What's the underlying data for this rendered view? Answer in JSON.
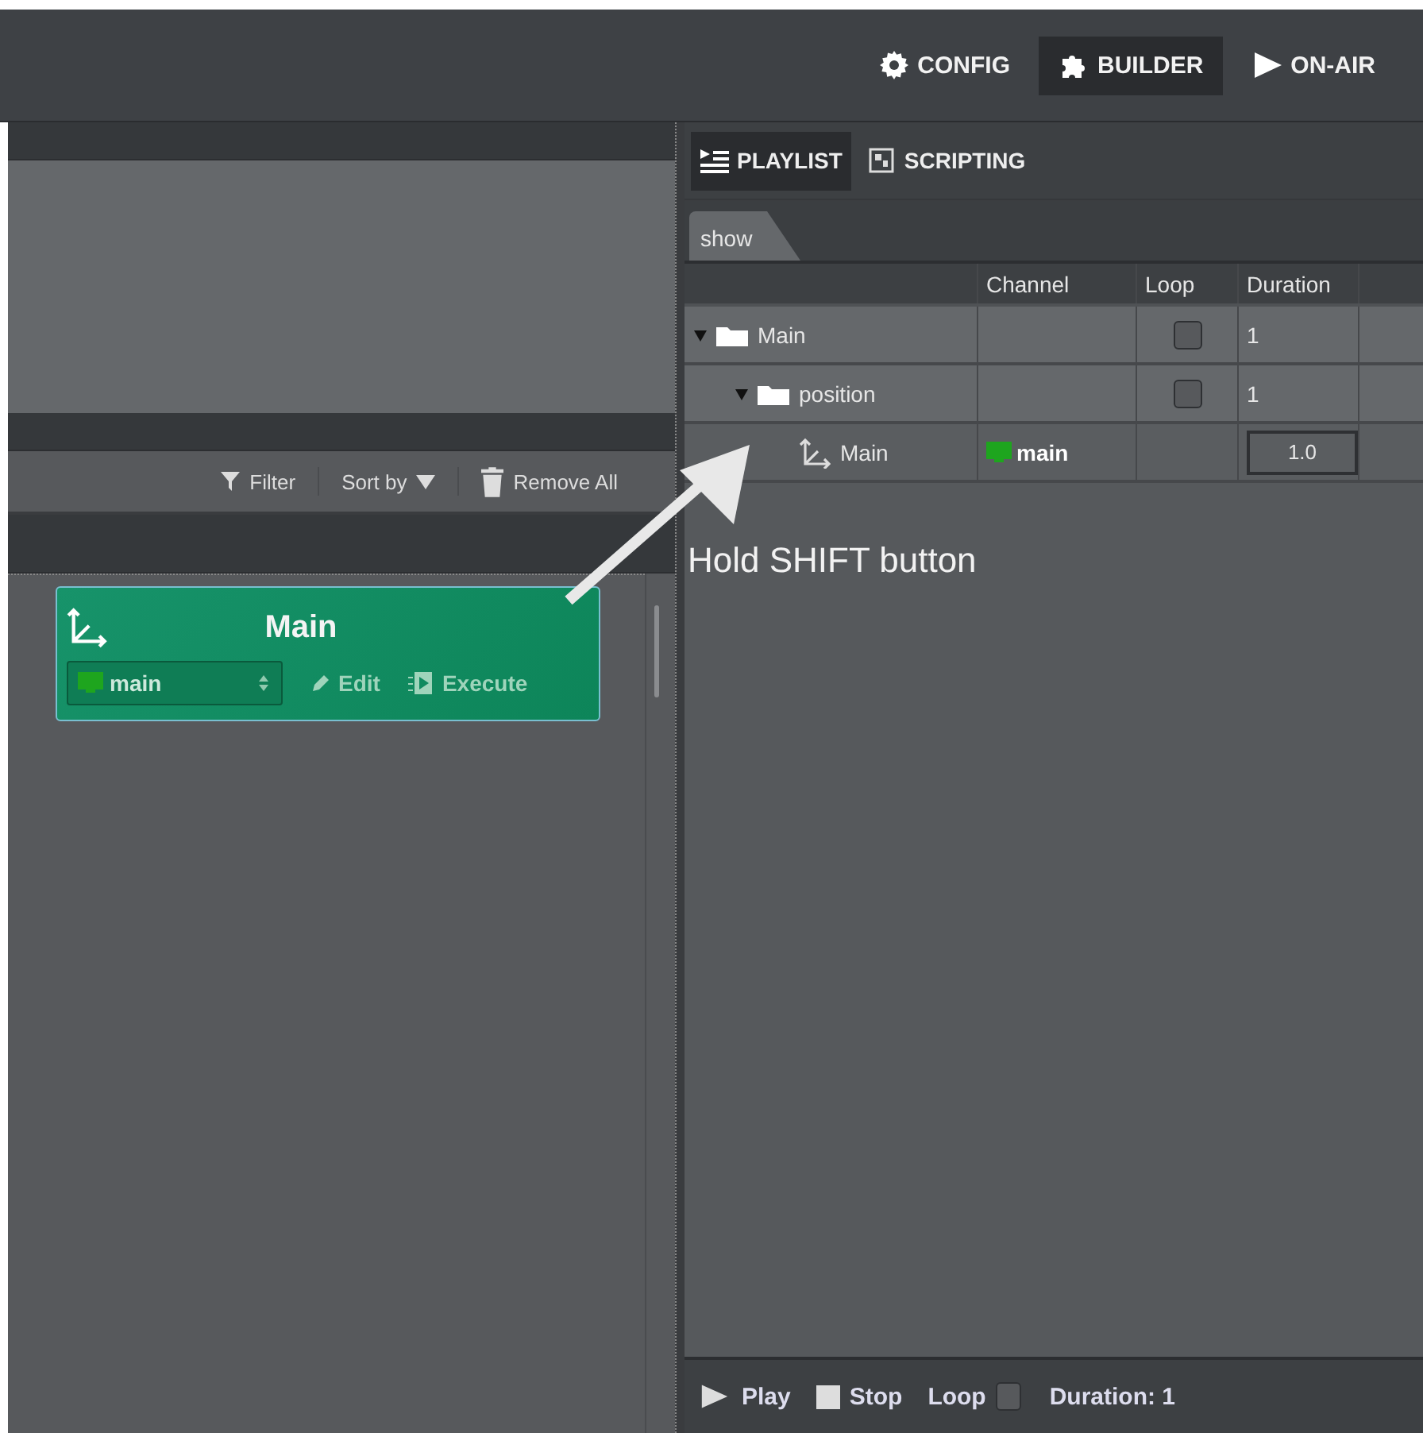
{
  "top_nav": [
    {
      "kind": "config",
      "label": "CONFIG",
      "selected": false
    },
    {
      "kind": "builder",
      "label": "BUILDER",
      "selected": true
    },
    {
      "kind": "onair",
      "label": "ON-AIR",
      "selected": false
    }
  ],
  "toolbar": {
    "filter": "Filter",
    "sort": "Sort by",
    "remove_all": "Remove All"
  },
  "template_card": {
    "title": "Main",
    "channel": "main",
    "edit": "Edit",
    "execute": "Execute"
  },
  "panel_tabs": [
    {
      "kind": "playlist",
      "label": "PLAYLIST",
      "selected": true
    },
    {
      "kind": "scripting",
      "label": "SCRIPTING",
      "selected": false
    }
  ],
  "playlist_tab": "show",
  "table": {
    "columns": [
      "Channel",
      "Loop",
      "Duration"
    ],
    "rows": [
      {
        "kind": "folder",
        "name": "Main",
        "expanded": true,
        "loop": false,
        "duration": "1",
        "children": [
          {
            "kind": "folder",
            "name": "position",
            "expanded": true,
            "loop": false,
            "duration": "1",
            "children": [
              {
                "kind": "item",
                "name": "Main",
                "channel": "main",
                "duration": "1.0"
              }
            ]
          }
        ]
      }
    ]
  },
  "annotation": "Hold SHIFT button",
  "transport": {
    "play": "Play",
    "stop": "Stop",
    "loop_label": "Loop",
    "loop": false,
    "duration": "Duration: 1"
  }
}
